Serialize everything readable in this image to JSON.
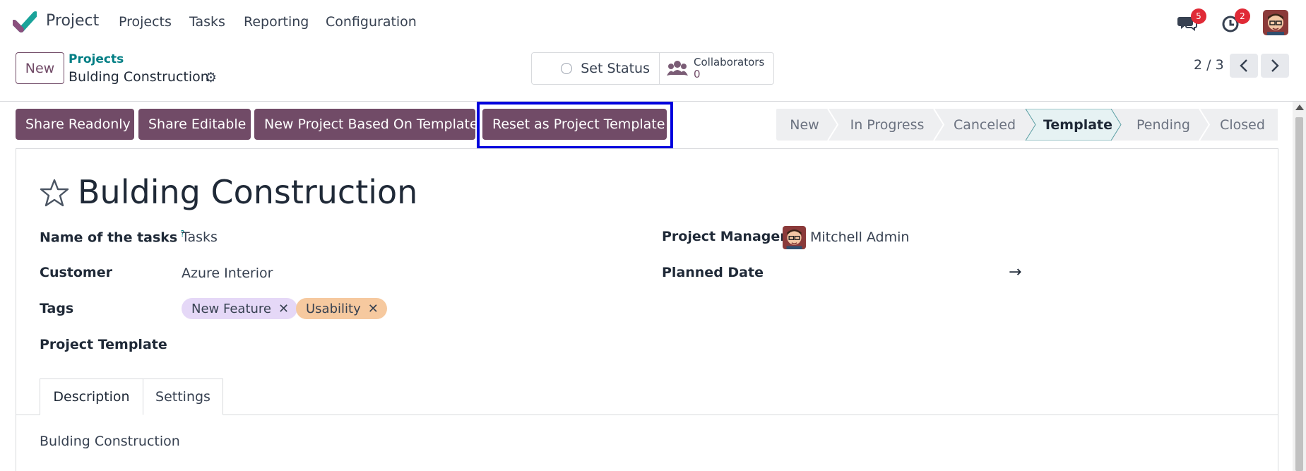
{
  "app": {
    "title": "Project",
    "menu": [
      "Projects",
      "Tasks",
      "Reporting",
      "Configuration"
    ]
  },
  "systray": {
    "messages_count": "5",
    "activities_count": "2"
  },
  "control_panel": {
    "new_label": "New",
    "breadcrumb_parent": "Projects",
    "breadcrumb_current": "Bulding Construction",
    "set_status_label": "Set Status",
    "collaborators_label": "Collaborators",
    "collaborators_count": "0",
    "pager": "2 / 3"
  },
  "actions": {
    "share_readonly": "Share Readonly",
    "share_editable": "Share Editable",
    "new_from_template": "New Project Based On Template",
    "reset_template": "Reset as Project Template"
  },
  "statusbar": {
    "stages": [
      "New",
      "In Progress",
      "Canceled",
      "Template",
      "Pending",
      "Closed"
    ],
    "active": "Template"
  },
  "form": {
    "title": "Bulding Construction",
    "name_of_tasks_label": "Name of the tasks",
    "name_of_tasks_help": "?",
    "name_of_tasks_value": "Tasks",
    "customer_label": "Customer",
    "customer_value": "Azure Interior",
    "tags_label": "Tags",
    "tags": [
      "New Feature",
      "Usability"
    ],
    "project_template_label": "Project Template",
    "project_manager_label": "Project Manager",
    "project_manager_value": "Mitchell Admin",
    "planned_date_label": "Planned Date",
    "planned_date_arrow": "→"
  },
  "tabs": {
    "description": "Description",
    "settings": "Settings"
  },
  "description_text": "Bulding Construction",
  "colors": {
    "brand": "#714b67",
    "link": "#017e84",
    "tag_new_feature": "#e5d8f7",
    "tag_usability": "#f6c99f",
    "active_stage_bg": "#e6f2f3",
    "highlight": "#0000dd"
  },
  "icons": [
    "project-logo-icon",
    "chat-icon",
    "clock-icon",
    "gear-icon",
    "users-icon",
    "chevron-left-icon",
    "chevron-right-icon",
    "star-icon",
    "close-icon",
    "arrow-right-icon"
  ]
}
